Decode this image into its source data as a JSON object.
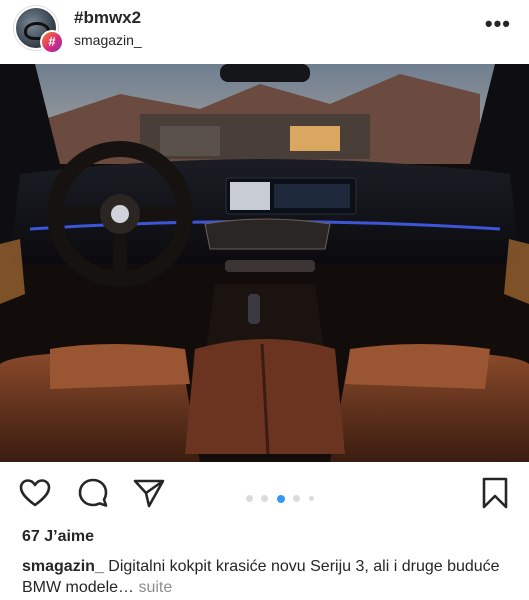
{
  "post": {
    "title": "#bmwx2",
    "username": "smagazin_",
    "hashtag_glyph": "#",
    "more_glyph": "•••"
  },
  "media": {
    "carousel_count": 5,
    "carousel_active_index": 2
  },
  "actions": {
    "like_icon": "heart-icon",
    "comment_icon": "comment-icon",
    "share_icon": "send-icon",
    "save_icon": "bookmark-icon"
  },
  "likes": {
    "text": "67 J’aime"
  },
  "caption": {
    "username": "smagazin_",
    "text": " Digitalni kokpit krasiće novu Seriju 3, ali i druge buduće BMW modele… ",
    "more_label": "suite"
  },
  "colors": {
    "text": "#262626",
    "muted": "#8e8e8e",
    "accent": "#3897f0",
    "dot_inactive": "#dbdbdb"
  }
}
